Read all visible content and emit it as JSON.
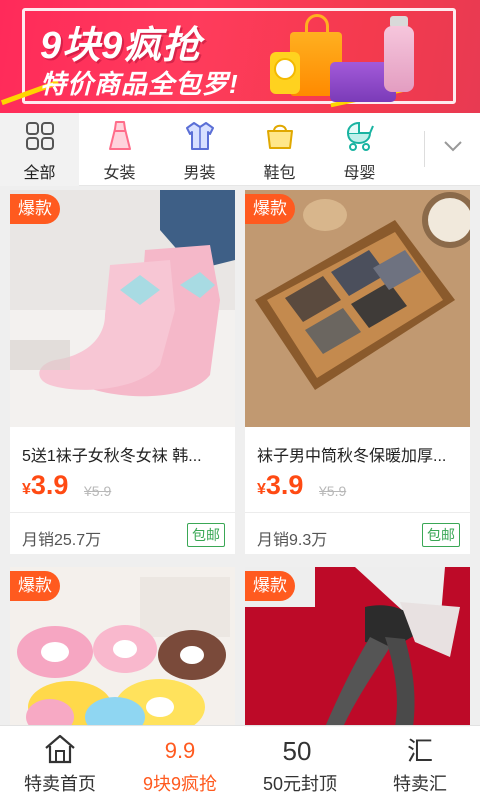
{
  "banner": {
    "title": "9块9疯抢",
    "subtitle": "特价商品全包罗!"
  },
  "categories": [
    {
      "label": "全部",
      "icon": "grid-icon",
      "active": true
    },
    {
      "label": "女装",
      "icon": "dress-icon",
      "active": false
    },
    {
      "label": "男装",
      "icon": "shirt-icon",
      "active": false
    },
    {
      "label": "鞋包",
      "icon": "handbag-icon",
      "active": false
    },
    {
      "label": "母婴",
      "icon": "stroller-icon",
      "active": false
    }
  ],
  "products": [
    {
      "badge": "爆款",
      "name": "5送1袜子女秋冬女袜 韩...",
      "currency": "¥",
      "price": "3.9",
      "original": "¥5.9",
      "sales": "月销25.7万",
      "shipping": "包邮"
    },
    {
      "badge": "爆款",
      "name": "袜子男中筒秋冬保暖加厚...",
      "currency": "¥",
      "price": "3.9",
      "original": "¥5.9",
      "sales": "月销9.3万",
      "shipping": "包邮"
    },
    {
      "badge": "爆款"
    },
    {
      "badge": "爆款"
    }
  ],
  "tabs": [
    {
      "label": "特卖首页",
      "icon": "home-icon",
      "active": false
    },
    {
      "label": "9块9疯抢",
      "icon": "nine-nine-icon",
      "icon_text": "9.9",
      "active": true
    },
    {
      "label": "50元封顶",
      "icon": "fifty-icon",
      "icon_text": "50",
      "active": false
    },
    {
      "label": "特卖汇",
      "icon": "hui-icon",
      "icon_text": "汇",
      "active": false
    }
  ],
  "colors": {
    "accent": "#ff5a1f",
    "banner": "#ff2a5a",
    "shipping_tag": "#3aa755"
  }
}
